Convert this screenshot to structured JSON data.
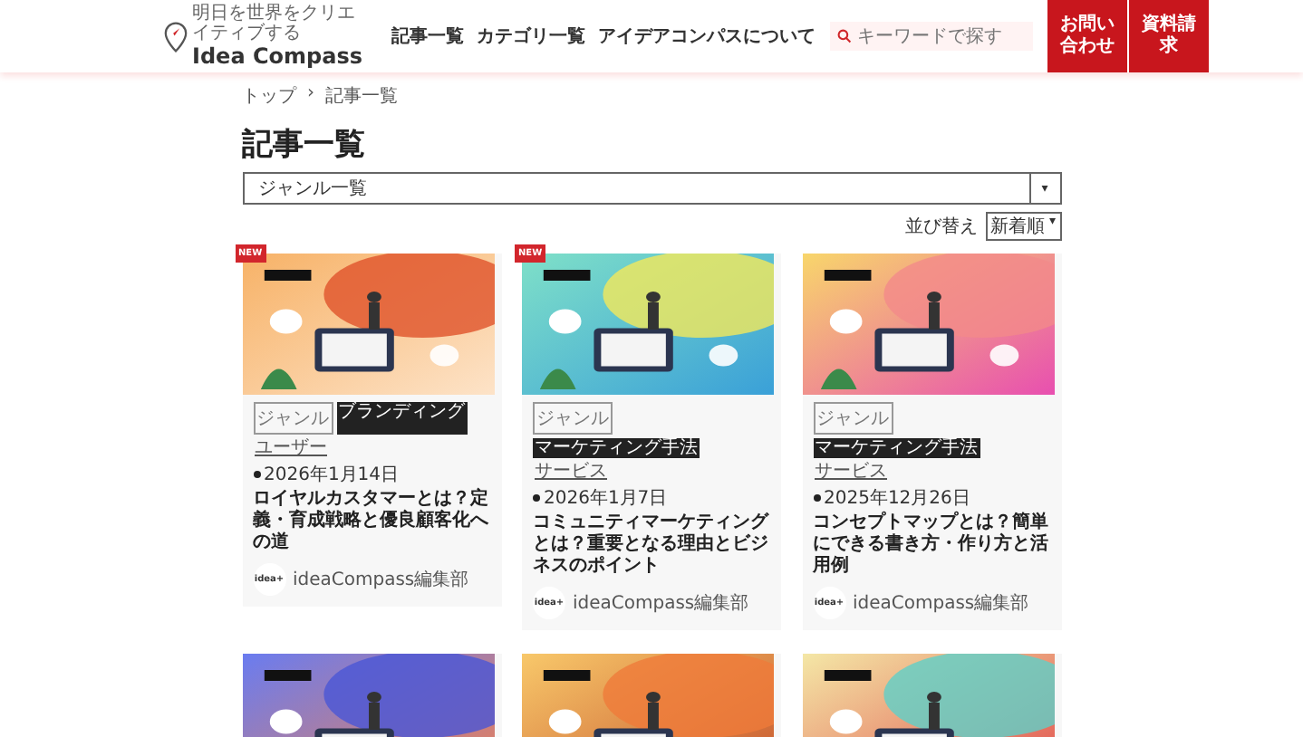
{
  "header": {
    "tagline": "明日を世界をクリエイティブする",
    "logo": "Idea Compass",
    "nav": [
      "記事一覧",
      "カテゴリ一覧",
      "アイデアコンパスについて"
    ],
    "search": {
      "placeholder": "キーワードで探す"
    },
    "buttons": [
      "お問い合わせ",
      "資料請求"
    ]
  },
  "breadcrumb": [
    "トップ",
    "›",
    "記事一覧"
  ],
  "title": "記事一覧",
  "genre_select": {
    "value": "ジャンル一覧",
    "arrow": "▾"
  },
  "sort": {
    "label": "並び替え",
    "value": "新着順",
    "arrow": "▾"
  },
  "articles": [
    {
      "badge": "NEW",
      "thumbnail": {
        "kind": "picture"
      },
      "tags": [
        "ジャンル",
        "ブランディング",
        "ユーザー"
      ],
      "date": "2026年1月14日",
      "title": "ロイヤルカスタマーとは？定義・育成戦略と優良顧客化への道",
      "avatar": "idea+",
      "author": "ideaCompass編集部"
    },
    {
      "badge": "NEW",
      "thumbnail": {
        "kind": "picture"
      },
      "tags": [
        "ジャンル",
        "マーケティング手法",
        "サービス"
      ],
      "date": "2026年1月7日",
      "title": "コミュニティマーケティングとは？重要となる理由とビジネスのポイント",
      "avatar": "idea+",
      "author": "ideaCompass編集部"
    },
    {
      "thumbnail": {
        "kind": "picture"
      },
      "tags": [
        "ジャンル",
        "マーケティング手法",
        "サービス"
      ],
      "date": "2025年12月26日",
      "title": "コンセプトマップとは？簡単にできる書き方・作り方と活用例",
      "avatar": "idea+",
      "author": "ideaCompass編集部"
    },
    {
      "thumbnail": {
        "kind": "picture"
      }
    },
    {
      "thumbnail": {
        "kind": "picture"
      }
    },
    {
      "thumbnail": {
        "kind": "picture"
      }
    }
  ]
}
